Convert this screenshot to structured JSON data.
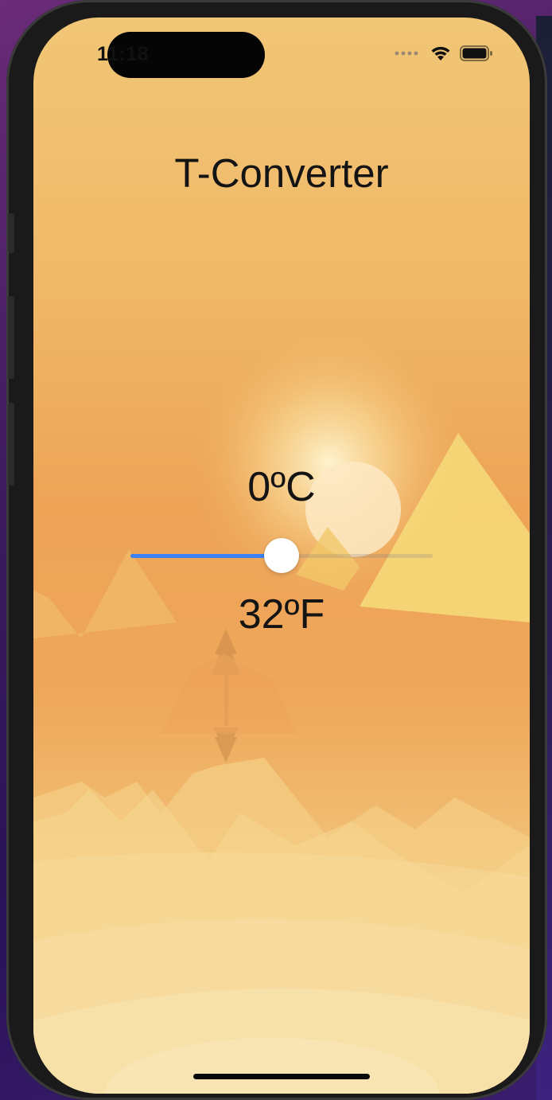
{
  "status_bar": {
    "time": "11:18"
  },
  "app": {
    "title": "T-Converter",
    "celsius_text": "0ºC",
    "fahrenheit_text": "32ºF"
  },
  "slider": {
    "value_fraction": 0.5,
    "fill_color": "#3a82f6"
  },
  "icons": [
    "cellular-signal-icon",
    "wifi-icon",
    "battery-icon"
  ]
}
